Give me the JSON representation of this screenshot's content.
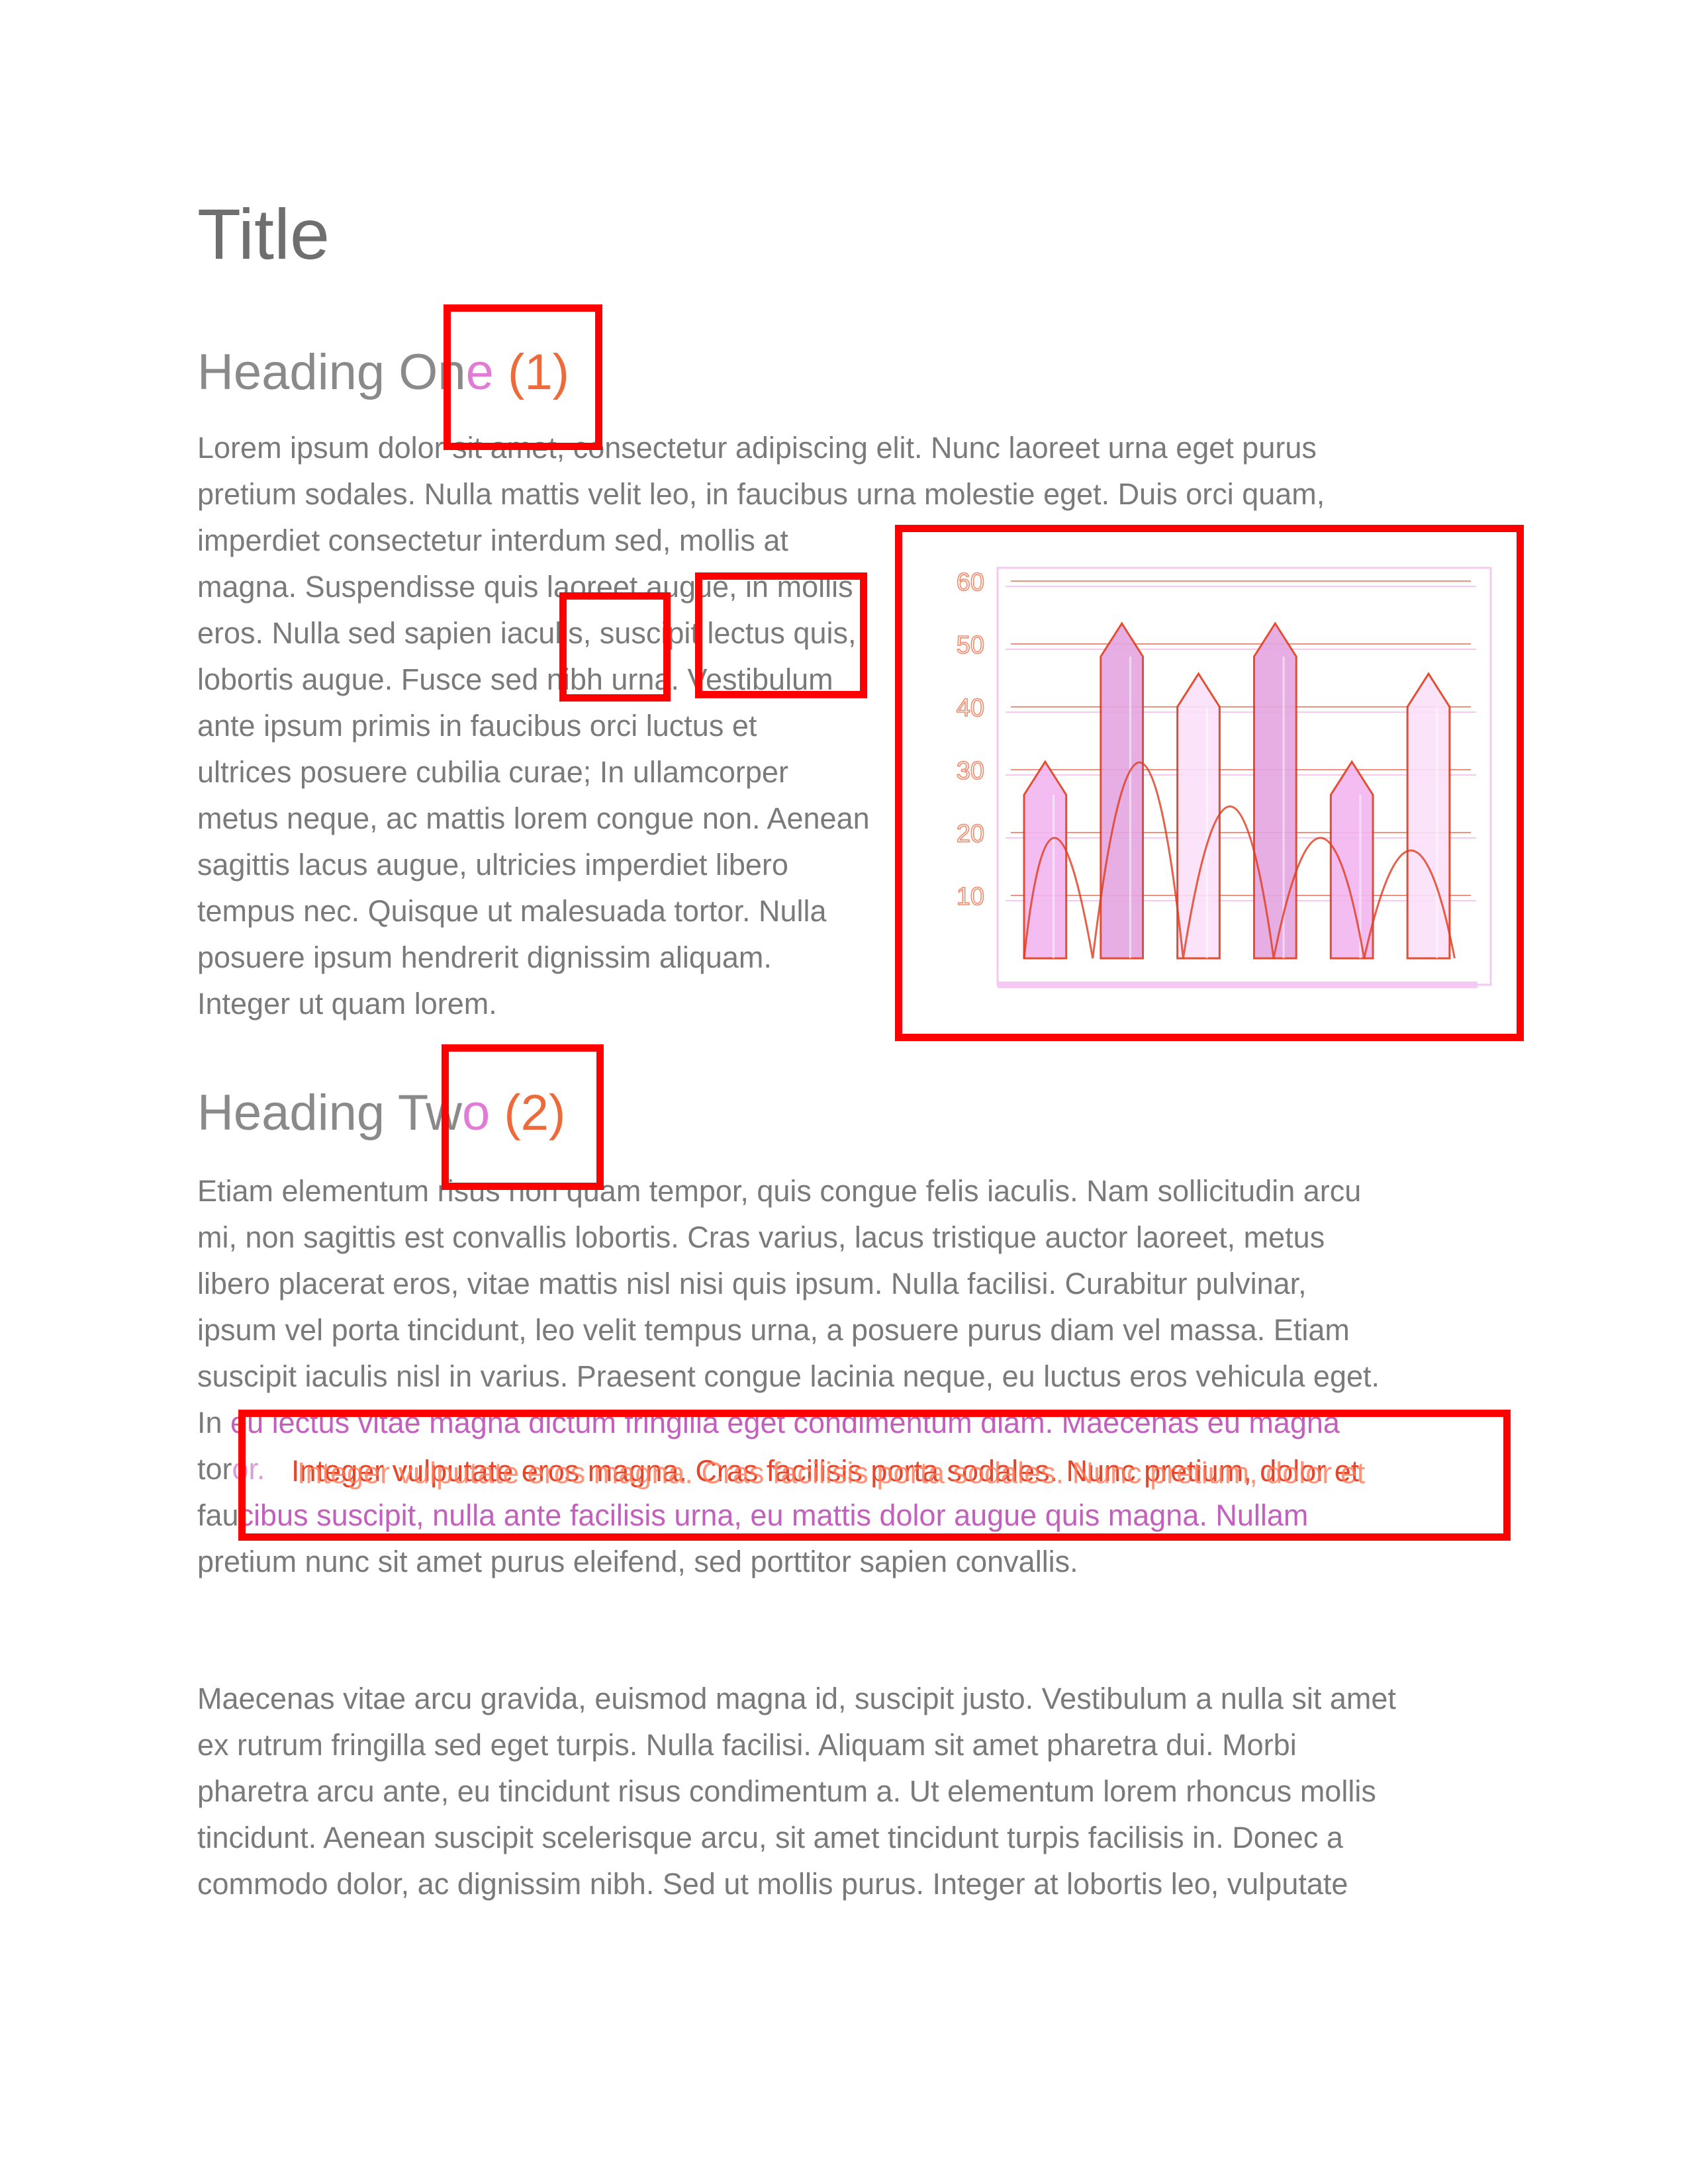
{
  "document": {
    "title": "Title",
    "heading1": {
      "text": "Heading On",
      "tail": "e",
      "num": "(1)"
    },
    "para1_lines": [
      "Lorem ipsum dolor sit amet, consectetur adipiscing elit. Nunc laoreet urna eget purus",
      "pretium sodales. Nulla mattis velit leo, in faucibus urna molestie eget. Duis orci quam,",
      "imperdiet consectetur interdum sed, mollis at",
      "magna. Suspendisse quis laoreet augue, in mollis",
      "eros. Nulla sed sapien iaculis, suscipit lectus quis,",
      "lobortis augue. Fusce sed nibh urna. Vestibulum",
      "ante ipsum primis in faucibus orci luctus et",
      "ultrices posuere cubilia curae; In ullamcorper",
      "metus neque, ac mattis lorem congue non. Aenean",
      "sagittis lacus augue, ultricies imperdiet libero",
      "tempus nec. Quisque ut malesuada tortor. Nulla",
      "posuere ipsum hendrerit dignissim aliquam.",
      "Integer ut quam lorem."
    ],
    "heading2": {
      "text": "Heading Tw",
      "tail": "o",
      "num": "(2)"
    },
    "para2_lines": [
      "Etiam elementum risus non quam tempor, quis congue felis iaculis. Nam sollicitudin arcu",
      "mi, non sagittis est convallis lobortis. Cras varius, lacus tristique auctor laoreet, metus",
      "libero placerat eros, vitae mattis nisl nisi quis ipsum. Nulla facilisi. Curabitur pulvinar,",
      "ipsum vel porta tincidunt, leo velit tempus urna, a posuere purus diam vel massa. Etiam",
      "suscipit iaculis nisl in varius. Praesent congue lacinia neque, eu luctus eros vehicula eget.",
      "In eu lectus vitae magna dictum fringilla eget condimentum diam. Maecenas eu magna",
      "tortor. Integer vulputate eros magna. Cras facilisis porta sodales. Nunc pretium, dolor et",
      "faucibus suscipit, nulla ante facilisis urna, eu mattis dolor augue quis magna. Nullam",
      "pretium nunc sit amet purus eleifend, sed porttitor sapien convallis."
    ],
    "para2_prefix": {
      "line6": "In ",
      "line7": "tor",
      "line8": "fau"
    },
    "para2_pink": {
      "line6": "eu lectus vitae magna dictum fringilla eget condimentum diam. Maecenas eu magna",
      "line8": "cibus suscipit, nulla ante facilisis urna, eu mattis dolor augue quis magna. Nullam"
    },
    "overlap_text_a": "Integer vulputate eros magna. Cras facilisis porta sodales. Nunc pretium, dolor et",
    "overlap_text_b": "Integer vulputate eros magna. Cras facilisis porta sodales. Nunc pretium, dolor et",
    "para3_lines": [
      "Maecenas vitae arcu gravida, euismod magna id, suscipit justo. Vestibulum a nulla sit amet",
      "ex rutrum fringilla sed eget turpis. Nulla facilisi. Aliquam sit amet pharetra dui. Morbi",
      "pharetra arcu ante, eu tincidunt risus condimentum a. Ut elementum lorem rhoncus mollis",
      "tincidunt. Aenean suscipit scelerisque arcu, sit amet tincidunt turpis facilisis in. Donec a",
      "commodo dolor, ac dignissim nibh. Sed ut mollis purus. Integer at lobortis leo, vulputate"
    ]
  },
  "colors": {
    "highlight_box": "#ff0000",
    "pink_text": "#c35fbc",
    "orange_text": "#e2472b",
    "bar_light": "#f3b6f0",
    "bar_mid": "#e5a6e0",
    "bar_pale": "#fbe0fa",
    "line_red": "#e03a1c"
  },
  "chart_data": {
    "type": "bar",
    "categories": [
      "",
      "",
      "",
      "",
      "",
      ""
    ],
    "series": [
      {
        "values": [
          26,
          48,
          40,
          48,
          26,
          40
        ]
      }
    ],
    "overlay_peaks": [
      32,
      56,
      42,
      32,
      28
    ],
    "yticks": [
      "10",
      "20",
      "30",
      "40",
      "50",
      "60"
    ],
    "ylim": [
      0,
      60
    ],
    "title": "",
    "xlabel": "",
    "ylabel": ""
  }
}
